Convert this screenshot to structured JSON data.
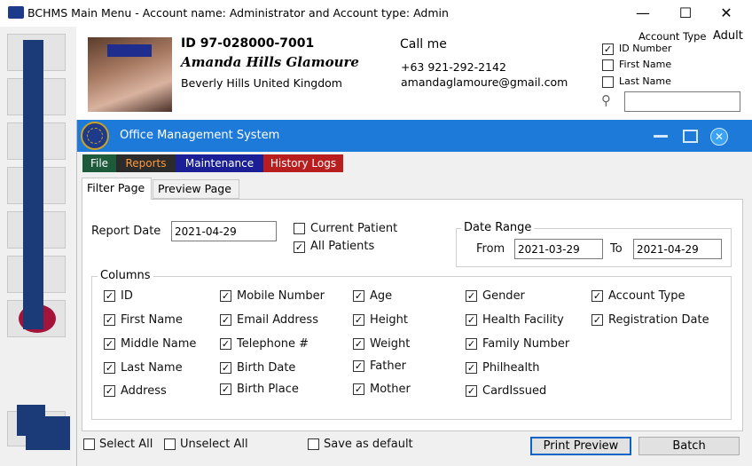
{
  "window": {
    "title": "BCHMS Main Menu  - Account name: Administrator and  Account type: Admin"
  },
  "profile": {
    "id": "ID  97-028000-7001",
    "name": "Amanda Hills Glamoure",
    "address": "Beverly Hills United Kingdom",
    "call_label": "Call me",
    "phone": "+63 921-292-2142",
    "email": "amandaglamoure@gmail.com",
    "account_type_label": "Account Type",
    "account_type_value": "Adult"
  },
  "search_options": [
    {
      "label": "ID Number",
      "checked": true
    },
    {
      "label": "First Name",
      "checked": false
    },
    {
      "label": "Last Name",
      "checked": false
    }
  ],
  "search": {
    "value": ""
  },
  "inner_window": {
    "title": "Office Management System"
  },
  "menu": [
    "File",
    "Reports",
    "Maintenance",
    "History Logs"
  ],
  "tabs": [
    "Filter Page",
    "Preview Page"
  ],
  "filter": {
    "report_date_label": "Report Date",
    "report_date_value": "2021-04-29",
    "current_patient_label": "Current Patient",
    "current_patient_checked": false,
    "all_patients_label": "All Patients",
    "all_patients_checked": true,
    "date_range_label": "Date Range",
    "from_label": "From",
    "from_value": "2021-03-29",
    "to_label": "To",
    "to_value": "2021-04-29"
  },
  "columns_group_label": "Columns",
  "columns": [
    [
      "ID",
      "First Name",
      "Middle Name",
      "Last Name",
      "Address"
    ],
    [
      "Mobile Number",
      "Email Address",
      "Telephone #",
      "Birth Date",
      "Birth Place"
    ],
    [
      "Age",
      "Height",
      "Weight",
      "Father",
      "Mother"
    ],
    [
      "Gender",
      "Health Facility",
      "Family Number",
      "Philhealth",
      "CardIssued"
    ],
    [
      "Account Type",
      "Registration Date"
    ]
  ],
  "footer": {
    "select_all": "Select All",
    "unselect_all": "Unselect All",
    "save_default": "Save as default",
    "print_preview": "Print Preview",
    "batch": "Batch"
  },
  "colors": {
    "title_bar_blue": "#1e7ad9",
    "menu_file": "#1c5a3a",
    "menu_reports": "#2b2b2b",
    "menu_maintenance": "#1a1f96",
    "menu_history": "#b81e1e"
  }
}
